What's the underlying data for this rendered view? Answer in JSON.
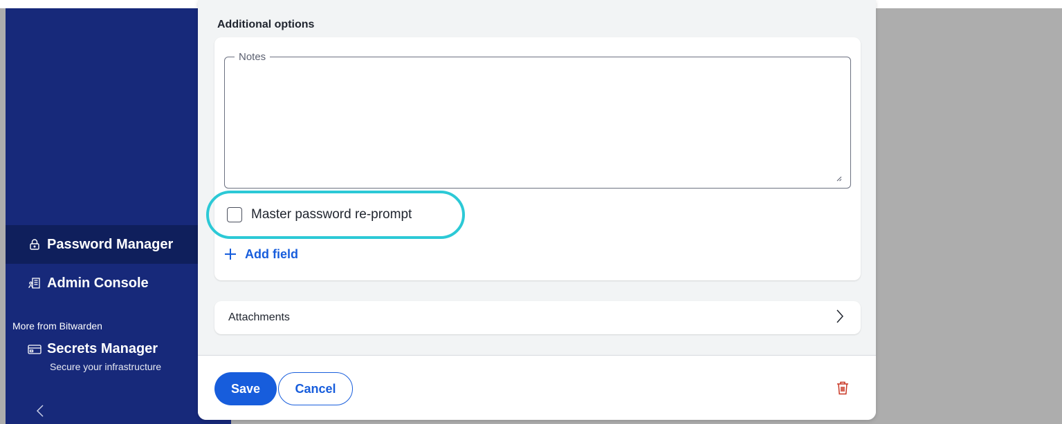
{
  "sidebar": {
    "items": [
      {
        "label": "Password Manager",
        "icon": "lock-icon",
        "active": true
      },
      {
        "label": "Admin Console",
        "icon": "building-icon",
        "active": false
      }
    ],
    "section_label": "More from Bitwarden",
    "product": {
      "label": "Secrets Manager",
      "subtitle": "Secure your infrastructure",
      "icon": "window-icon"
    },
    "collapse_icon": "chevron-left-icon"
  },
  "dialog": {
    "section_title": "Additional options",
    "notes": {
      "legend": "Notes",
      "value": ""
    },
    "reprompt": {
      "label": "Master password re-prompt",
      "checked": false
    },
    "add_field_label": "Add field",
    "attachments_label": "Attachments",
    "footer": {
      "save_label": "Save",
      "cancel_label": "Cancel",
      "delete_icon": "trash-icon"
    }
  },
  "colors": {
    "sidebar_bg": "#17297a",
    "sidebar_active": "#0f1f5c",
    "primary": "#175ddc",
    "highlight_ring": "#2cc9d6",
    "danger": "#c83522",
    "overlay": "#adadad"
  }
}
